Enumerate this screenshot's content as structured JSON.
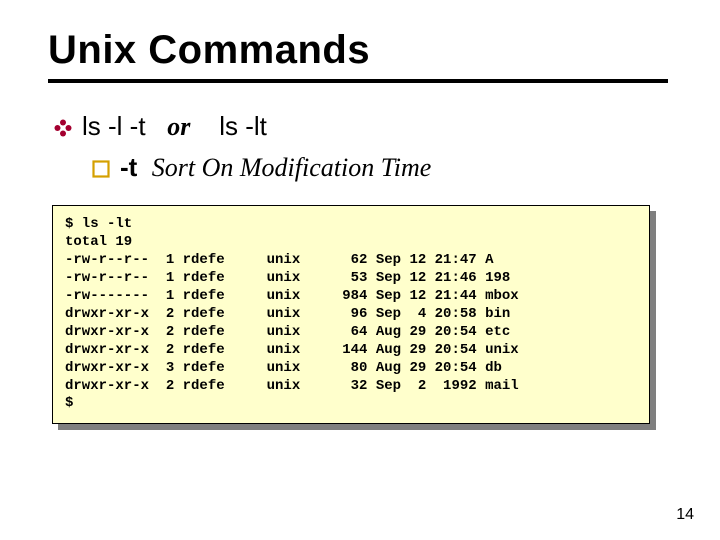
{
  "title": "Unix Commands",
  "line1": {
    "cmd1": "ls -l -t",
    "or": "or",
    "cmd2": "ls -lt"
  },
  "line2": {
    "flag": "-t",
    "desc": "Sort On Modification Time"
  },
  "terminal": {
    "prompt1": "$ ls -lt",
    "total": "total 19",
    "rows": [
      {
        "perm": "-rw-r--r--",
        "lnk": "1",
        "own": "rdefe",
        "grp": "unix",
        "size": "62",
        "mon": "Sep",
        "day": "12",
        "time": "21:47",
        "name": "A"
      },
      {
        "perm": "-rw-r--r--",
        "lnk": "1",
        "own": "rdefe",
        "grp": "unix",
        "size": "53",
        "mon": "Sep",
        "day": "12",
        "time": "21:46",
        "name": "198"
      },
      {
        "perm": "-rw-------",
        "lnk": "1",
        "own": "rdefe",
        "grp": "unix",
        "size": "984",
        "mon": "Sep",
        "day": "12",
        "time": "21:44",
        "name": "mbox"
      },
      {
        "perm": "drwxr-xr-x",
        "lnk": "2",
        "own": "rdefe",
        "grp": "unix",
        "size": "96",
        "mon": "Sep",
        "day": "4",
        "time": "20:58",
        "name": "bin"
      },
      {
        "perm": "drwxr-xr-x",
        "lnk": "2",
        "own": "rdefe",
        "grp": "unix",
        "size": "64",
        "mon": "Aug",
        "day": "29",
        "time": "20:54",
        "name": "etc"
      },
      {
        "perm": "drwxr-xr-x",
        "lnk": "2",
        "own": "rdefe",
        "grp": "unix",
        "size": "144",
        "mon": "Aug",
        "day": "29",
        "time": "20:54",
        "name": "unix"
      },
      {
        "perm": "drwxr-xr-x",
        "lnk": "3",
        "own": "rdefe",
        "grp": "unix",
        "size": "80",
        "mon": "Aug",
        "day": "29",
        "time": "20:54",
        "name": "db"
      },
      {
        "perm": "drwxr-xr-x",
        "lnk": "2",
        "own": "rdefe",
        "grp": "unix",
        "size": "32",
        "mon": "Sep",
        "day": "2",
        "time": "1992",
        "name": "mail"
      }
    ],
    "prompt2": "$"
  },
  "page": "14"
}
